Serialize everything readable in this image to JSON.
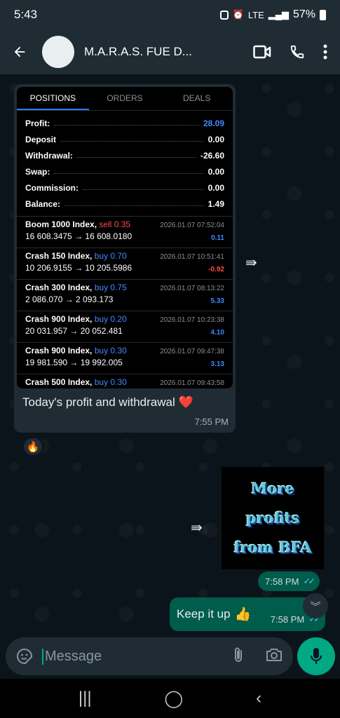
{
  "status_bar": {
    "time": "5:43",
    "network": "LTE",
    "battery_percent": "57%"
  },
  "header": {
    "back_icon": "arrow-left-icon",
    "contact_name": "M.A.R.A.S. FUE D...",
    "video_call_icon": "video-camera-icon",
    "voice_call_icon": "phone-icon",
    "menu_icon": "more-vertical-icon"
  },
  "screenshot": {
    "tabs": [
      "POSITIONS",
      "ORDERS",
      "DEALS"
    ],
    "summary": [
      {
        "label": "Profit:",
        "value": "28.09",
        "color": "#3b8cff"
      },
      {
        "label": "Deposit",
        "value": "0.00",
        "color": "#ffffff"
      },
      {
        "label": "Withdrawal:",
        "value": "-26.60",
        "color": "#ffffff"
      },
      {
        "label": "Swap:",
        "value": "0.00",
        "color": "#ffffff"
      },
      {
        "label": "Commission:",
        "value": "0.00",
        "color": "#ffffff"
      },
      {
        "label": "Balance:",
        "value": "1.49",
        "color": "#ffffff"
      }
    ],
    "deals": [
      {
        "symbol": "Boom 1000 Index,",
        "direction": "sell 0.35",
        "dir_type": "sell",
        "prices": "16 608.3475 → 16 608.0180",
        "datetime": "2026.01.07 07:52:04",
        "profit": "0.11",
        "profit_type": "blue"
      },
      {
        "symbol": "Crash 150 Index,",
        "direction": "buy 0.70",
        "dir_type": "buy",
        "prices": "10 206.9155 → 10 205.5986",
        "datetime": "2026.01.07 10:51:41",
        "profit": "-0.92",
        "profit_type": "red"
      },
      {
        "symbol": "Crash 300 Index,",
        "direction": "buy 0.75",
        "dir_type": "buy",
        "prices": "2 086.070 → 2 093.173",
        "datetime": "2026.01.07 08:13:22",
        "profit": "5.33",
        "profit_type": "blue"
      },
      {
        "symbol": "Crash 900 Index,",
        "direction": "buy 0.20",
        "dir_type": "buy",
        "prices": "20 031.957 → 20 052.481",
        "datetime": "2026.01.07 10:23:38",
        "profit": "4.10",
        "profit_type": "blue"
      },
      {
        "symbol": "Crash 900 Index,",
        "direction": "buy 0.30",
        "dir_type": "buy",
        "prices": "19 981.590 → 19 992.005",
        "datetime": "2026.01.07 09:47:38",
        "profit": "3.13",
        "profit_type": "blue"
      },
      {
        "symbol": "Crash 500 Index,",
        "direction": "buy 0.30",
        "dir_type": "buy",
        "prices": "",
        "datetime": "2026.01.07 09:43:58",
        "profit": "",
        "profit_type": "blue"
      }
    ]
  },
  "incoming_message": {
    "caption": "Today's profit and withdrawal",
    "emoji": "❤️",
    "time": "7:55 PM",
    "reaction": "🔥"
  },
  "outgoing_image": {
    "lines": [
      "More",
      "profits",
      "from BFA"
    ],
    "time": "7:58 PM"
  },
  "outgoing_message": {
    "text": "Keep it up",
    "emoji": "👍",
    "time": "7:58 PM"
  },
  "input": {
    "placeholder": "Message"
  },
  "colors": {
    "outgoing_bubble": "#005c4b",
    "incoming_bubble": "#1f2c34",
    "accent": "#00a884",
    "read_ticks": "#53bdeb"
  }
}
